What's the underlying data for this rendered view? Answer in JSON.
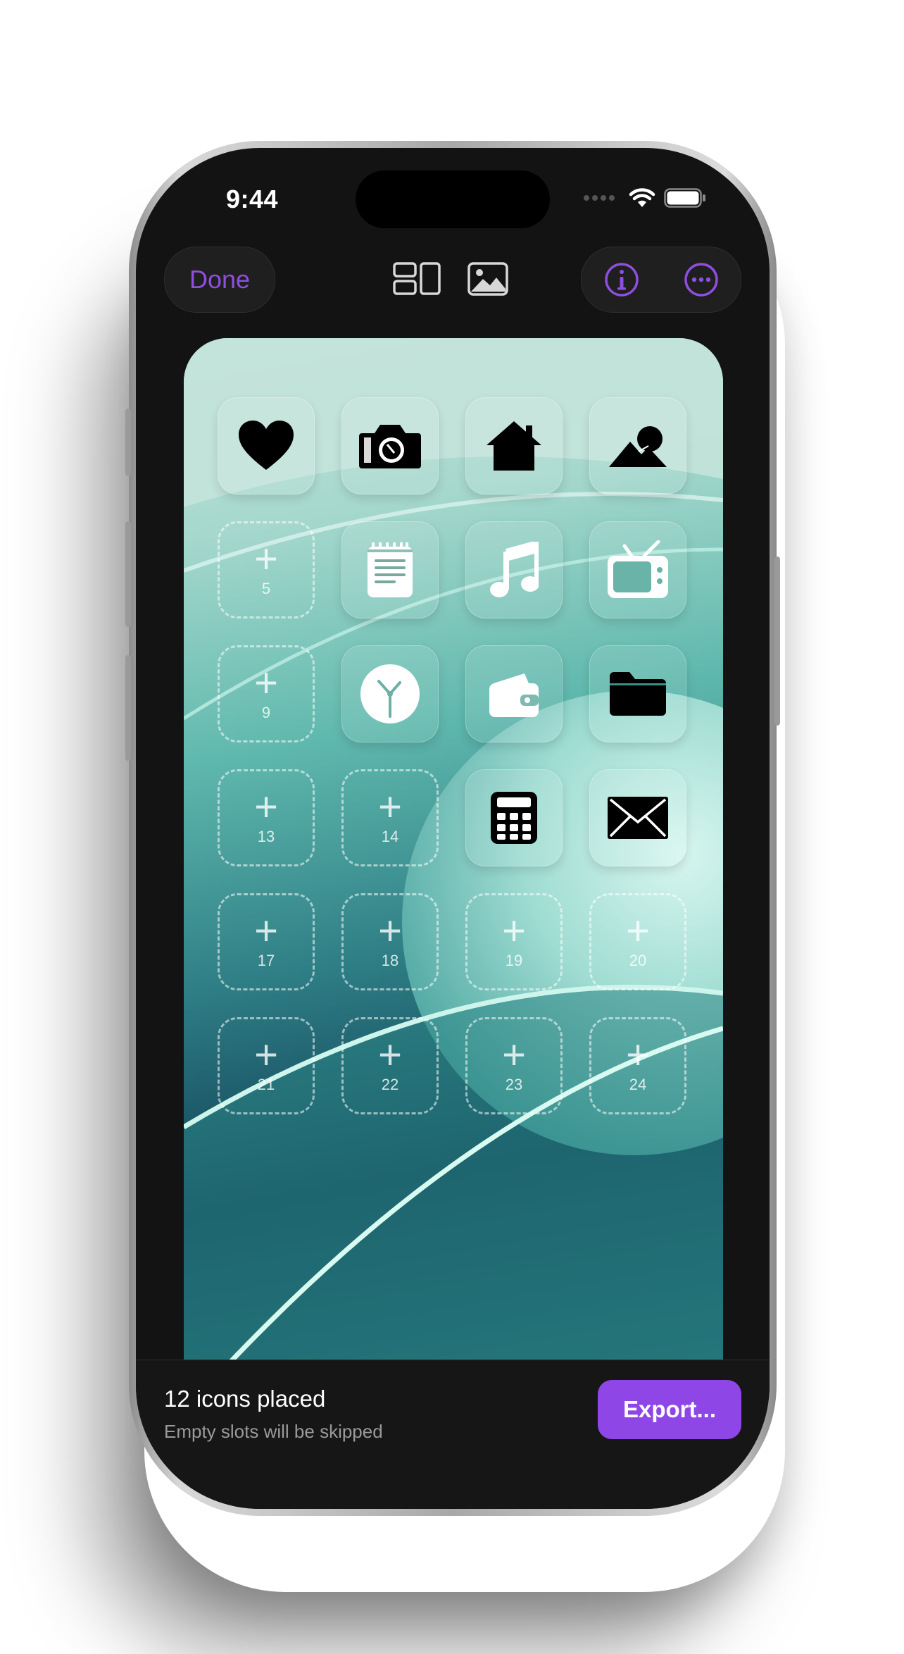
{
  "status_bar": {
    "time": "9:44"
  },
  "toolbar": {
    "done_label": "Done",
    "tools": [
      "layout-icon",
      "image-icon",
      "info-icon",
      "more-icon"
    ],
    "accent": "#8f46e6"
  },
  "grid": {
    "rows": 6,
    "columns": 4,
    "slots": [
      {
        "slot": 1,
        "icon": "heart-icon"
      },
      {
        "slot": 2,
        "icon": "camera-icon"
      },
      {
        "slot": 3,
        "icon": "house-icon"
      },
      {
        "slot": 4,
        "icon": "mountain-icon"
      },
      {
        "slot": 5,
        "label": "5"
      },
      {
        "slot": 6,
        "icon": "notepad-icon"
      },
      {
        "slot": 7,
        "icon": "music-note-icon"
      },
      {
        "slot": 8,
        "icon": "tv-icon"
      },
      {
        "slot": 9,
        "label": "9"
      },
      {
        "slot": 10,
        "icon": "clock-icon"
      },
      {
        "slot": 11,
        "icon": "wallet-icon"
      },
      {
        "slot": 12,
        "icon": "folder-icon"
      },
      {
        "slot": 13,
        "label": "13"
      },
      {
        "slot": 14,
        "label": "14"
      },
      {
        "slot": 15,
        "icon": "calculator-icon"
      },
      {
        "slot": 16,
        "icon": "envelope-icon"
      },
      {
        "slot": 17,
        "label": "17"
      },
      {
        "slot": 18,
        "label": "18"
      },
      {
        "slot": 19,
        "label": "19"
      },
      {
        "slot": 20,
        "label": "20"
      },
      {
        "slot": 21,
        "label": "21"
      },
      {
        "slot": 22,
        "label": "22"
      },
      {
        "slot": 23,
        "label": "23"
      },
      {
        "slot": 24,
        "label": "24"
      }
    ]
  },
  "footer": {
    "title": "12 icons placed",
    "subtitle": "Empty slots will be skipped",
    "export_label": "Export..."
  }
}
